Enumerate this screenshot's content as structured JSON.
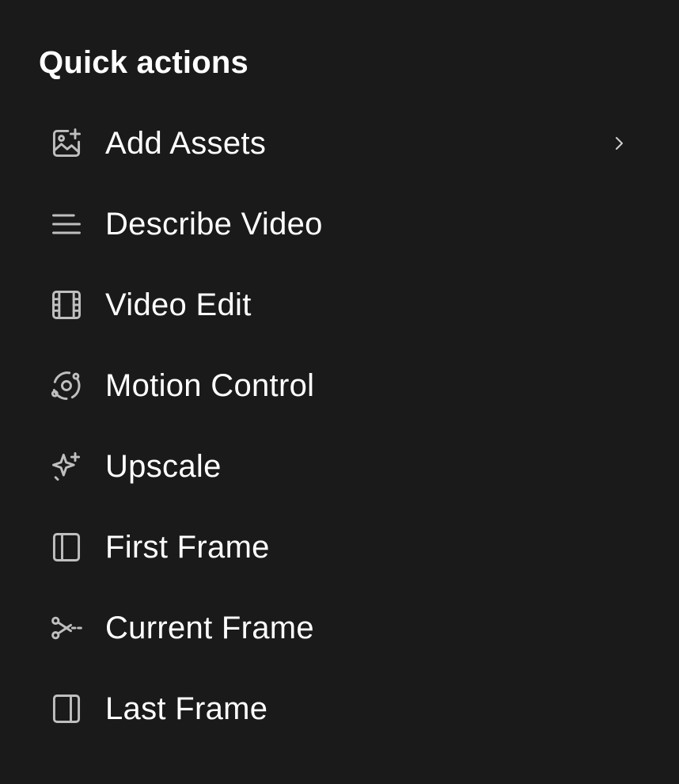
{
  "panel": {
    "title": "Quick actions"
  },
  "items": [
    {
      "label": "Add Assets",
      "icon": "image-add-icon",
      "has_submenu": true
    },
    {
      "label": "Describe Video",
      "icon": "text-lines-icon"
    },
    {
      "label": "Video Edit",
      "icon": "film-icon"
    },
    {
      "label": "Motion Control",
      "icon": "orbit-icon"
    },
    {
      "label": "Upscale",
      "icon": "sparkle-icon"
    },
    {
      "label": "First Frame",
      "icon": "panel-left-icon"
    },
    {
      "label": "Current Frame",
      "icon": "scissors-icon"
    },
    {
      "label": "Last Frame",
      "icon": "panel-right-icon"
    }
  ],
  "colors": {
    "background": "#1a1a1a",
    "text": "#ffffff",
    "icon": "#bfbfbf"
  }
}
